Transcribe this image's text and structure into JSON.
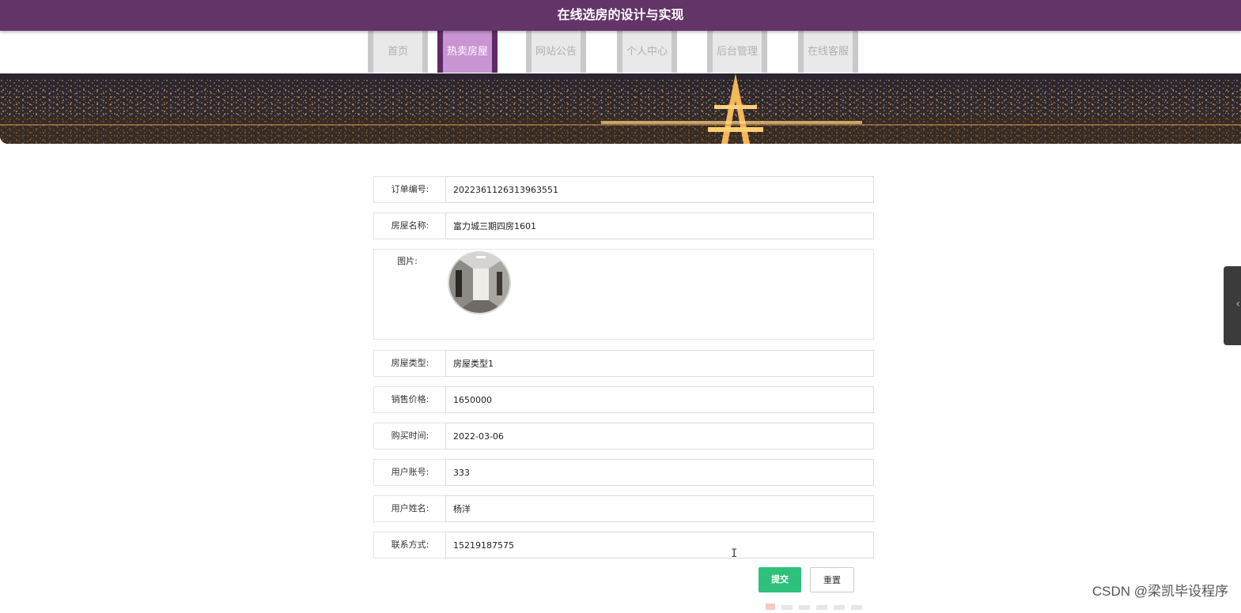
{
  "header": {
    "title": "在线选房的设计与实现"
  },
  "nav": {
    "items": [
      {
        "label": "首页",
        "active": false
      },
      {
        "label": "热卖房屋",
        "active": true
      },
      {
        "label": "网站公告",
        "active": false
      },
      {
        "label": "个人中心",
        "active": false
      },
      {
        "label": "后台管理",
        "active": false
      },
      {
        "label": "在线客服",
        "active": false
      }
    ]
  },
  "form": {
    "order_no": {
      "label": "订单编号:",
      "value": "2022361126313963551"
    },
    "house_name": {
      "label": "房屋名称:",
      "value": "富力城三期四房1601"
    },
    "image": {
      "label": "图片:"
    },
    "house_type": {
      "label": "房屋类型:",
      "value": "房屋类型1"
    },
    "price": {
      "label": "销售价格:",
      "value": "1650000"
    },
    "purchase_date": {
      "label": "购买时间:",
      "value": "2022-03-06"
    },
    "user_account": {
      "label": "用户账号:",
      "value": "333"
    },
    "user_name": {
      "label": "用户姓名:",
      "value": "杨洋"
    },
    "contact": {
      "label": "联系方式:",
      "value": "15219187575"
    }
  },
  "buttons": {
    "submit": "提交",
    "reset": "重置"
  },
  "watermark": "CSDN @梁凯毕设程序",
  "colors": {
    "header_bg": "#633468",
    "nav_active": "#c894d2",
    "submit": "#2ec17c"
  }
}
